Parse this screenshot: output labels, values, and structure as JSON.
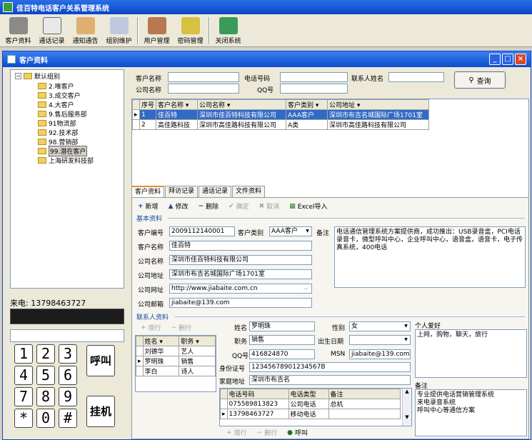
{
  "app_title": "佳百特电话客户关系管理系统",
  "toolbar": {
    "items": [
      "客户资料",
      "通话记录",
      "通知通告",
      "组别维护",
      "用户管理",
      "密码管理",
      "关闭系统"
    ]
  },
  "window_title": "客户资料",
  "tree": {
    "root": "默认组别",
    "items": [
      "2.唯客户",
      "3.成交客户",
      "4.大客户",
      "9.售后服务部",
      "91物流部",
      "92.技术部",
      "98.营销部",
      "99.潜在客户",
      "上海研发科技部"
    ],
    "selected": "99.潜在客户"
  },
  "phone": {
    "caller_label": "来电:",
    "caller_number": "13798463727",
    "keys": [
      "1",
      "2",
      "3",
      "4",
      "5",
      "6",
      "7",
      "8",
      "9",
      "*",
      "0",
      "#"
    ],
    "call_button": "呼叫",
    "hangup_button": "挂机"
  },
  "search": {
    "customer_name_label": "客户名称",
    "phone_label": "电话号码",
    "contact_label": "联系人姓名",
    "company_label": "公司名称",
    "qq_label": "QQ号",
    "query_button": "查询"
  },
  "grid": {
    "headers": [
      "序号",
      "客户名称",
      "公司名称",
      "客户类别",
      "公司地址"
    ],
    "rows": [
      [
        "1",
        "佳百特",
        "深圳市佳百特科技有限公司",
        "AAA客户",
        "深圳市布吉名城国际广场1701室"
      ],
      [
        "2",
        "高佳路科技",
        "深圳市高佳路科技有限公司",
        "A类",
        "深圳市高佳路科技有限公司"
      ]
    ]
  },
  "tabs": [
    "客户资料",
    "拜访记录",
    "通话记录",
    "文件资料"
  ],
  "actions": {
    "new": "新增",
    "edit": "修改",
    "delete": "删除",
    "confirm": "确定",
    "cancel": "取消",
    "excel": "Excel导入"
  },
  "basic": {
    "section_title": "基本资料",
    "code_label": "客户编号",
    "code": "2009112140001",
    "type_label": "客户类别",
    "type": "AAA客户",
    "remark_label": "备注",
    "remark": "电话通信管理系统方案提供商，成功推出：USB录音盒，PCI电话录音卡，微型呼叫中心，企业呼叫中心，语音盒，语音卡，电子传真系统，400电话",
    "name_label": "客户名称",
    "name": "佳百特",
    "company_label": "公司名称",
    "company": "深圳市佳百特科技有限公司",
    "address_label": "公司地址",
    "address": "深圳市布吉名城国际广场1701室",
    "website_label": "公司网址",
    "website": "http://www.jiabaite.com.cn",
    "email_label": "公司邮箱",
    "email": "jiabaite@139.com"
  },
  "contact": {
    "section_title": "联系人资料",
    "add_row": "增行",
    "del_row": "删行",
    "list_headers": [
      "姓名",
      "职务"
    ],
    "list_rows": [
      [
        "刘德华",
        "艺人"
      ],
      [
        "罗明珠",
        "销售"
      ],
      [
        "李白",
        "诗人"
      ]
    ],
    "name_label": "姓名",
    "name": "罗明珠",
    "gender_label": "性别",
    "gender": "女",
    "hobby_label": "个人爱好",
    "hobby": "上网，购物，聊天，旅行",
    "title_label": "职务",
    "title": "销售",
    "birthday_label": "出生日期",
    "qq_label": "QQ号",
    "qq": "416824870",
    "msn_label": "MSN",
    "msn": "jiabaite@139.com",
    "id_label": "身份证号",
    "id": "12345678901234567B",
    "home_label": "家庭地址",
    "home": "深圳市布吉名",
    "phone_headers": [
      "电话号码",
      "电话类型",
      "备注"
    ],
    "phone_rows": [
      [
        "075589813823",
        "公司电话",
        "总机"
      ],
      [
        "13798463727",
        "移动电话",
        ""
      ]
    ],
    "call": "呼叫",
    "note_label": "备注",
    "note_lines": [
      "专业提供电话营销管理系统",
      "来电录音系统",
      "呼叫中心等通信方案"
    ]
  }
}
